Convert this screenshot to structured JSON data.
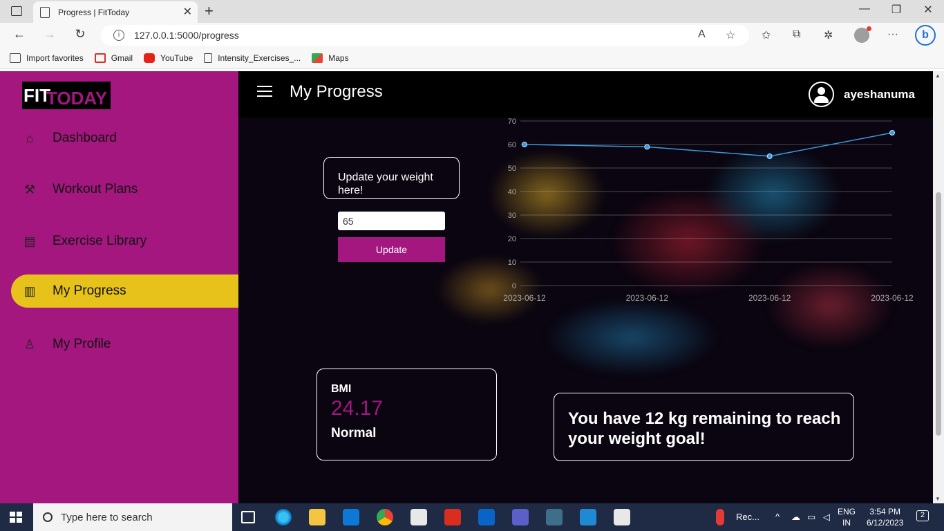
{
  "browser": {
    "tab_title": "Progress | FitToday",
    "url": "127.0.0.1:5000/progress",
    "bookmarks": [
      "Import favorites",
      "Gmail",
      "YouTube",
      "Intensity_Exercises_...",
      "Maps"
    ]
  },
  "sidebar": {
    "logo_fit": "FIT",
    "logo_today": "TODAY",
    "items": [
      {
        "label": "Dashboard",
        "icon": "home-icon"
      },
      {
        "label": "Workout Plans",
        "icon": "dumbbell-icon"
      },
      {
        "label": "Exercise Library",
        "icon": "clipboard-icon"
      },
      {
        "label": "My Progress",
        "icon": "bar-chart-icon",
        "active": true
      },
      {
        "label": "My Profile",
        "icon": "user-icon"
      }
    ]
  },
  "header": {
    "title": "My Progress",
    "username": "ayeshanuma"
  },
  "update": {
    "prompt": "Update your weight here!",
    "weight_value": "65",
    "button_label": "Update"
  },
  "chart_data": {
    "type": "line",
    "categories": [
      "2023-06-12",
      "2023-06-12",
      "2023-06-12",
      "2023-06-12"
    ],
    "values": [
      60,
      59,
      55,
      65
    ],
    "ylim": [
      0,
      70
    ],
    "yticks": [
      0,
      10,
      20,
      30,
      40,
      50,
      60,
      70
    ],
    "grid": true,
    "color": "#3a9bdc"
  },
  "bmi": {
    "label": "BMI",
    "value": "24.17",
    "status": "Normal"
  },
  "goal": {
    "message": "You have 12 kg remaining to reach your weight goal!"
  },
  "taskbar": {
    "search_placeholder": "Type here to search",
    "weather": "Rec...",
    "lang1": "ENG",
    "lang2": "IN",
    "time": "3:54 PM",
    "date": "6/12/2023",
    "notifications": "2"
  },
  "colors": {
    "brand": "#a3177e",
    "active": "#e6c21a"
  }
}
